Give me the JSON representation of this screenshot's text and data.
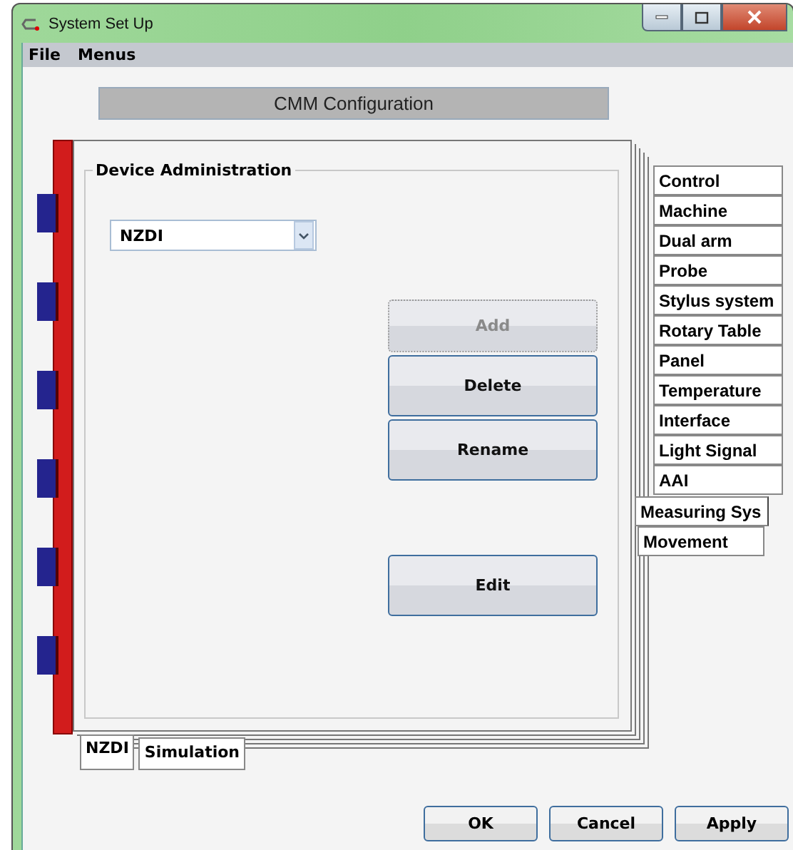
{
  "window": {
    "title": "System Set Up"
  },
  "menu": [
    "File",
    "Menus"
  ],
  "header": "CMM Configuration",
  "right_tabs": [
    {
      "label": "Control",
      "selected": false,
      "kind": "back"
    },
    {
      "label": "Machine",
      "selected": false,
      "kind": "back"
    },
    {
      "label": "Dual arm",
      "selected": false,
      "kind": "back"
    },
    {
      "label": "Probe",
      "selected": false,
      "kind": "back"
    },
    {
      "label": "Stylus system",
      "selected": false,
      "kind": "back"
    },
    {
      "label": "Rotary Table",
      "selected": false,
      "kind": "back"
    },
    {
      "label": "Panel",
      "selected": false,
      "kind": "back"
    },
    {
      "label": "Temperature",
      "selected": false,
      "kind": "back"
    },
    {
      "label": "Interface",
      "selected": false,
      "kind": "back"
    },
    {
      "label": "Light Signal",
      "selected": false,
      "kind": "back"
    },
    {
      "label": "AAI",
      "selected": false,
      "kind": "back"
    },
    {
      "label": "Measuring Sys",
      "selected": true,
      "kind": "front"
    },
    {
      "label": "Movement",
      "selected": false,
      "kind": "front"
    }
  ],
  "group": {
    "title": "Device Administration",
    "device": {
      "value": "NZDI"
    },
    "buttons": [
      {
        "label": "Add",
        "disabled": true
      },
      {
        "label": "Delete",
        "disabled": false
      },
      {
        "label": "Rename",
        "disabled": false
      },
      {
        "label": "Edit",
        "disabled": false
      }
    ]
  },
  "bottom_tabs": [
    {
      "label": "NZDI",
      "selected": true
    },
    {
      "label": "Simulation",
      "selected": false
    }
  ],
  "dialog_buttons": [
    "OK",
    "Cancel",
    "Apply"
  ]
}
